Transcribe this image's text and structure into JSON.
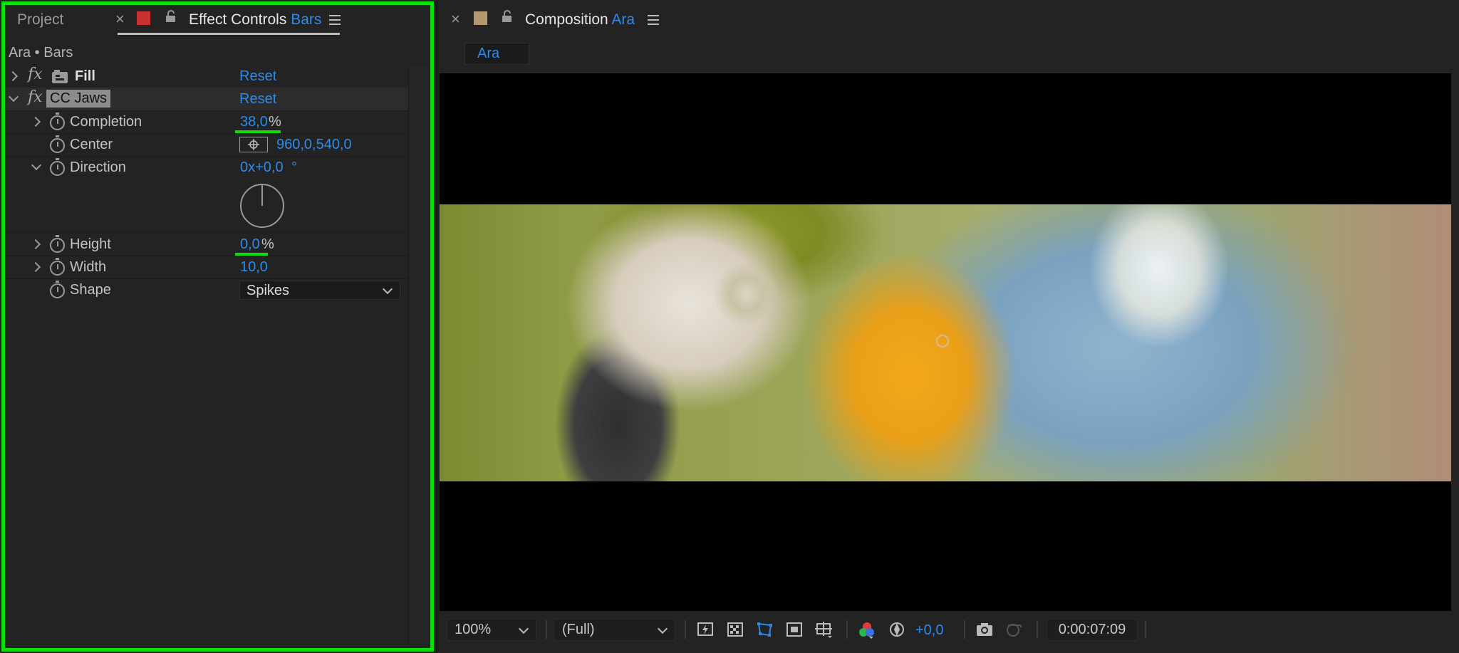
{
  "effect_controls_panel": {
    "project_tab": "Project",
    "close_glyph": "×",
    "effect_controls_tab": "Effect Controls",
    "layer_name": "Bars",
    "breadcrumb": "Ara • Bars",
    "effects": [
      {
        "name": "Fill",
        "reset": "Reset"
      },
      {
        "name": "CC Jaws",
        "reset": "Reset"
      }
    ],
    "properties": {
      "completion": {
        "label": "Completion",
        "value": "38,0",
        "unit": "%"
      },
      "center": {
        "label": "Center",
        "value": "960,0,540,0"
      },
      "direction": {
        "label": "Direction",
        "value": "0x+0,0",
        "unit": "°"
      },
      "height": {
        "label": "Height",
        "value": "0,0",
        "unit": "%"
      },
      "width": {
        "label": "Width",
        "value": "10,0"
      },
      "shape": {
        "label": "Shape",
        "value": "Spikes"
      }
    }
  },
  "composition_panel": {
    "close_glyph": "×",
    "title": "Composition",
    "comp_name": "Ara",
    "comp_tab": "Ara"
  },
  "viewer_toolbar": {
    "zoom": "100%",
    "resolution": "(Full)",
    "exposure": "+0,0",
    "timecode": "0:00:07:09"
  },
  "colors": {
    "highlight_border": "#0be00b",
    "accent_blue": "#2d8ceb",
    "panel_bg": "#232323",
    "label_swatch_red": "#c83232",
    "label_swatch_tan": "#b29a6e"
  }
}
